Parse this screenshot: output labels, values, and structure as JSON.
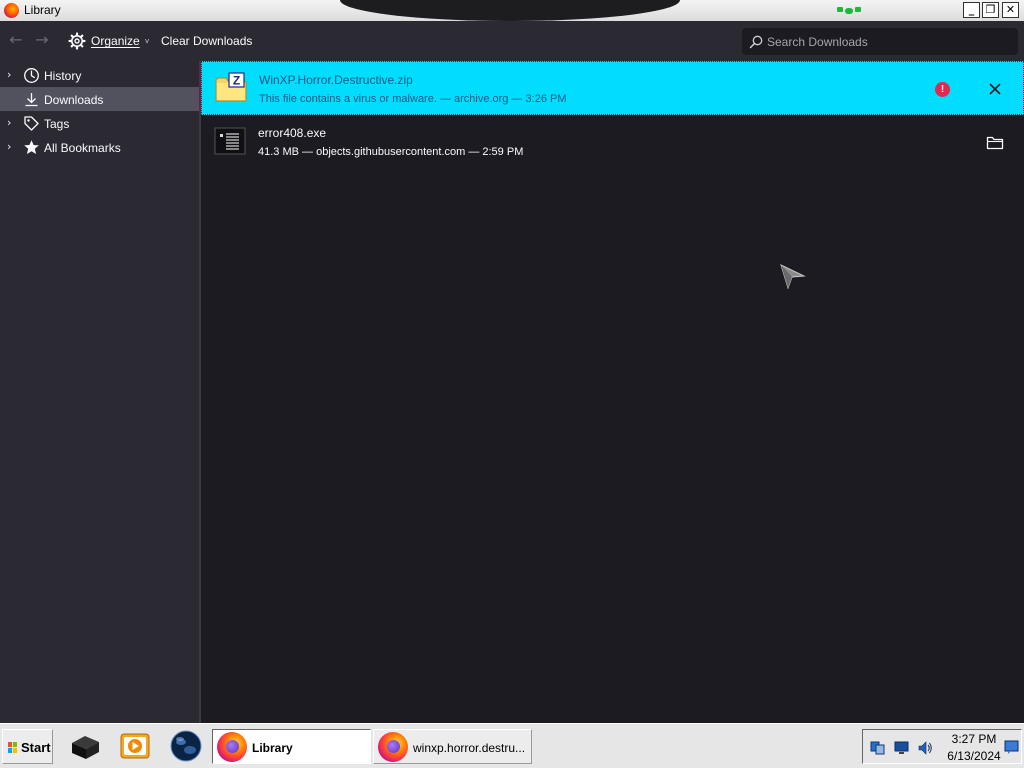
{
  "window": {
    "title": "Library",
    "minimize_glyph": "_",
    "restore_glyph": "❐",
    "close_glyph": "✕"
  },
  "toolbar": {
    "back_glyph": "←",
    "forward_glyph": "→",
    "organize_label": "Organize",
    "organize_caret": "˅",
    "clear_downloads_label": "Clear Downloads",
    "search_placeholder": "Search Downloads"
  },
  "sidebar": {
    "items": [
      {
        "label": "History",
        "icon": "clock-icon",
        "expandable": true,
        "selected": false
      },
      {
        "label": "Downloads",
        "icon": "download-icon",
        "expandable": false,
        "selected": true
      },
      {
        "label": "Tags",
        "icon": "tag-icon",
        "expandable": true,
        "selected": false
      },
      {
        "label": "All Bookmarks",
        "icon": "star-icon",
        "expandable": true,
        "selected": false
      }
    ],
    "twisty_glyph": "›"
  },
  "downloads": [
    {
      "filename": "WinXP.Horror.Destructive.zip",
      "status": "This file contains a virus or malware. — archive.org — 3:26 PM",
      "icon": "zip-archive-icon",
      "state": "blocked-malware",
      "warning_glyph": "!",
      "action_icon": "close-icon"
    },
    {
      "filename": "error408.exe",
      "status": "41.3 MB — objects.githubusercontent.com — 2:59 PM",
      "icon": "executable-icon",
      "state": "completed",
      "action_icon": "folder-icon"
    }
  ],
  "taskbar": {
    "start_label": "Start",
    "quick_launch": [
      "show-desktop-icon",
      "media-player-icon",
      "globe-icon"
    ],
    "tasks": [
      {
        "label": "Library",
        "active": true,
        "icon": "firefox-icon"
      },
      {
        "label": "winxp.horror.destru...",
        "active": false,
        "icon": "firefox-icon"
      }
    ],
    "tray_icons": [
      "network-icon",
      "monitor-icon",
      "volume-icon"
    ],
    "time": "3:27 PM",
    "date": "6/13/2024"
  },
  "colors": {
    "alert_row_bg": "#00ddff",
    "alert_text": "#0a5a82",
    "warning_red": "#e22850",
    "content_bg": "#1c1b22",
    "toolbar_bg": "#2b2a33",
    "selected_sidebar_bg": "#52525e"
  }
}
